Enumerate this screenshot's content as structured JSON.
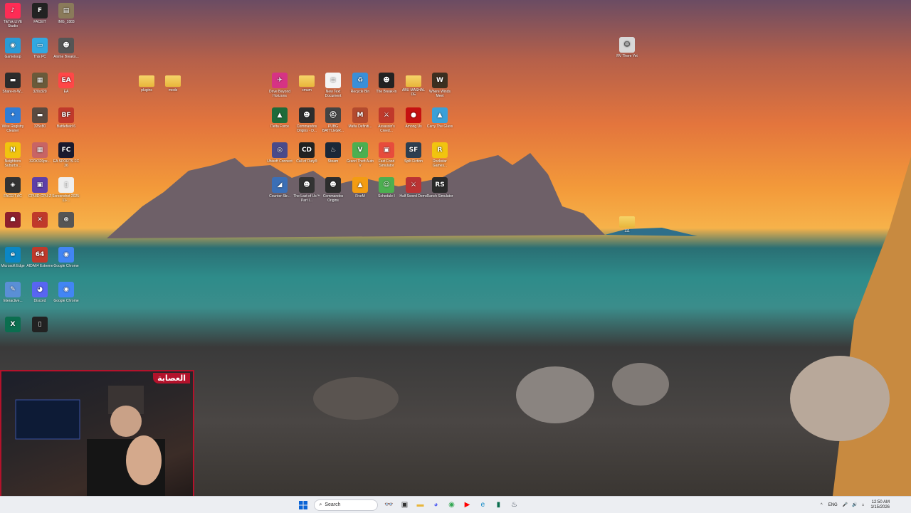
{
  "desktop": {
    "icons_left": [
      {
        "label": "TikTok LIVE Studio",
        "color": "#fe2c55",
        "glyph": "♪"
      },
      {
        "label": "FACEIT",
        "color": "#222",
        "glyph": "F"
      },
      {
        "label": "IMG_1883",
        "color": "#8a7a5a",
        "glyph": "▤"
      },
      {
        "label": "Gameloop",
        "color": "#2b9bd6",
        "glyph": "◉"
      },
      {
        "label": "This PC",
        "color": "#32a8e0",
        "glyph": "▭"
      },
      {
        "label": "Anime Breako...",
        "color": "#555",
        "glyph": "☻"
      },
      {
        "label": "Share-in-W...",
        "color": "#2c2c2c",
        "glyph": "▬"
      },
      {
        "label": "320x320",
        "color": "#6a5a3a",
        "glyph": "▦"
      },
      {
        "label": "EA",
        "color": "#ff4747",
        "glyph": "EA"
      },
      {
        "label": "Wise Registry Cleaner",
        "color": "#2f7dd6",
        "glyph": "✦"
      },
      {
        "label": "325x80",
        "color": "#5a4a40",
        "glyph": "▬"
      },
      {
        "label": "Battlefield 6",
        "color": "#c0392b",
        "glyph": "BF"
      },
      {
        "label": "Neighbors Suburbs...",
        "color": "#f1c40f",
        "glyph": "N"
      },
      {
        "label": "320X320px...",
        "color": "#c86464",
        "glyph": "▦"
      },
      {
        "label": "EA SPORTS FC 26",
        "color": "#1a1a2e",
        "glyph": "FC"
      },
      {
        "label": "FACEIT AC",
        "color": "#333",
        "glyph": "◈"
      },
      {
        "label": "CPUID CPU-Z",
        "color": "#5e3fa8",
        "glyph": "▣"
      },
      {
        "label": "Screenshot 2025-11-...",
        "color": "#eee",
        "glyph": "▯"
      },
      {
        "label": "",
        "color": "#8e1f2c",
        "glyph": "☗"
      },
      {
        "label": "",
        "color": "#c0392b",
        "glyph": "✕"
      },
      {
        "label": "",
        "color": "#555",
        "glyph": "⊛"
      },
      {
        "label": "Microsoft Edge",
        "color": "#0b87c5",
        "glyph": "e"
      },
      {
        "label": "AIDA64 Extreme",
        "color": "#c0392b",
        "glyph": "64"
      },
      {
        "label": "Google Chrome",
        "color": "#4285f4",
        "glyph": "◉"
      },
      {
        "label": "Interactive...",
        "color": "#5a8fd6",
        "glyph": "✎"
      },
      {
        "label": "Discord",
        "color": "#5865f2",
        "glyph": "◕"
      },
      {
        "label": "Google Chrome",
        "color": "#4285f4",
        "glyph": "◉"
      },
      {
        "label": "",
        "color": "#0b6e4f",
        "glyph": "X"
      },
      {
        "label": "",
        "color": "#222",
        "glyph": "▯"
      }
    ],
    "folders_mid": [
      {
        "label": "plugins"
      },
      {
        "label": "mods"
      }
    ],
    "grid_icons": [
      {
        "label": "Drive Beyond Horizons",
        "color": "#d63384",
        "glyph": "✈"
      },
      {
        "label": "cmum",
        "color": "#f6d469",
        "glyph": "▬"
      },
      {
        "label": "New Text Document",
        "color": "#f4f4f4",
        "glyph": "≡"
      },
      {
        "label": "Recycle Bin",
        "color": "#3a8fd8",
        "glyph": "♻"
      },
      {
        "label": "The Break-In",
        "color": "#222",
        "glyph": "☻"
      },
      {
        "label": "ABU MASHAL DE",
        "color": "#f6d469",
        "glyph": "▬"
      },
      {
        "label": "Where Winds Meet",
        "color": "#3b2f20",
        "glyph": "W"
      },
      {
        "label": "Delta Force",
        "color": "#1e6b3a",
        "glyph": "▲"
      },
      {
        "label": "Commandos Origins - D...",
        "color": "#2d2d2d",
        "glyph": "☻"
      },
      {
        "label": "PUBG BATTLEGR...",
        "color": "#444",
        "glyph": "⛑"
      },
      {
        "label": "Mafia Definiti...",
        "color": "#b34a2e",
        "glyph": "M"
      },
      {
        "label": "Assassin's Creed...",
        "color": "#c0392b",
        "glyph": "⚔"
      },
      {
        "label": "Among Us",
        "color": "#c51111",
        "glyph": "●"
      },
      {
        "label": "Carry The Glass",
        "color": "#3aa0d8",
        "glyph": "▲"
      },
      {
        "label": "Ubisoft Connect",
        "color": "#4a4a8a",
        "glyph": "◎"
      },
      {
        "label": "Call of Duty®",
        "color": "#222",
        "glyph": "CD"
      },
      {
        "label": "Steam",
        "color": "#1b2838",
        "glyph": "♨"
      },
      {
        "label": "Grand Theft Auto V",
        "color": "#4caf50",
        "glyph": "V"
      },
      {
        "label": "Fast Food Simulator",
        "color": "#e74c3c",
        "glyph": "▣"
      },
      {
        "label": "Spilt Fiction",
        "color": "#2c3e50",
        "glyph": "SF"
      },
      {
        "label": "Rockstar Games...",
        "color": "#f1c40f",
        "glyph": "R"
      },
      {
        "label": "Counter-Str...",
        "color": "#3b6fb6",
        "glyph": "◢"
      },
      {
        "label": "The Last of Us™ Part I...",
        "color": "#333",
        "glyph": "☻"
      },
      {
        "label": "Commandos Origins",
        "color": "#2d2d2d",
        "glyph": "☻"
      },
      {
        "label": "FiveM",
        "color": "#f39c12",
        "glyph": "▲"
      },
      {
        "label": "Schedule I",
        "color": "#4caf50",
        "glyph": "☺"
      },
      {
        "label": "Half Sword Demo",
        "color": "#b33",
        "glyph": "⚔"
      },
      {
        "label": "Ranch Simulator",
        "color": "#2a2a2a",
        "glyph": "RS"
      }
    ],
    "icon_right": {
      "label": "RV There Yet",
      "color": "#d8d8d8",
      "glyph": "☺"
    },
    "folder_far_right": {
      "label": "111"
    }
  },
  "webcam": {
    "badge": "العصابة"
  },
  "taskbar": {
    "search_placeholder": "Search",
    "apps": [
      {
        "name": "glasses-icon",
        "glyph": "👓",
        "color": "#333"
      },
      {
        "name": "task-view-icon",
        "glyph": "▣",
        "color": "#333"
      },
      {
        "name": "file-explorer-icon",
        "glyph": "▬",
        "color": "#e8b63b"
      },
      {
        "name": "discord-icon",
        "glyph": "◕",
        "color": "#5865f2"
      },
      {
        "name": "chrome-icon",
        "glyph": "◉",
        "color": "#34a853"
      },
      {
        "name": "youtube-icon",
        "glyph": "▶",
        "color": "#ff0000"
      },
      {
        "name": "edge-icon",
        "glyph": "e",
        "color": "#0b87c5"
      },
      {
        "name": "terminal-icon",
        "glyph": "▮",
        "color": "#0b6e4f"
      },
      {
        "name": "steam-icon",
        "glyph": "♨",
        "color": "#1b2838"
      }
    ],
    "lang": "ENG",
    "time": "12:50 AM",
    "date": "1/15/2026"
  }
}
